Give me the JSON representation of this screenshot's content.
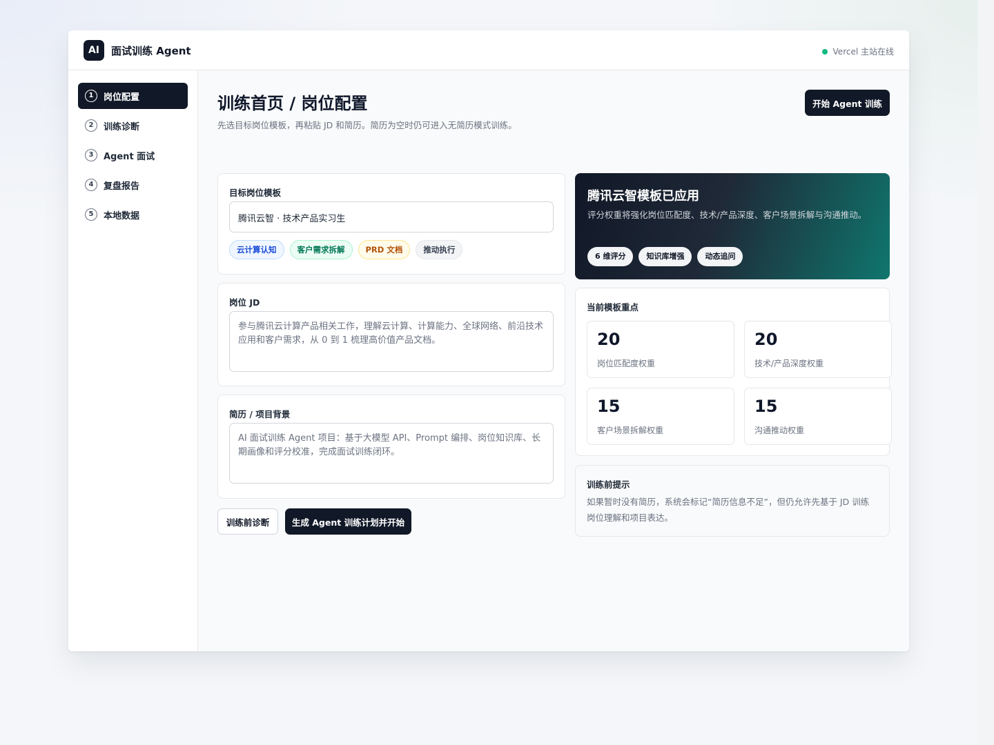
{
  "app": {
    "logo": "AI",
    "title": "面试训练 Agent",
    "status": "Vercel 主站在线"
  },
  "sidebar": {
    "items": [
      {
        "num": "1",
        "label": "岗位配置"
      },
      {
        "num": "2",
        "label": "训练诊断"
      },
      {
        "num": "3",
        "label": "Agent 面试"
      },
      {
        "num": "4",
        "label": "复盘报告"
      },
      {
        "num": "5",
        "label": "本地数据"
      }
    ]
  },
  "page": {
    "title": "训练首页 / 岗位配置",
    "subtitle": "先选目标岗位模板，再粘贴 JD 和简历。简历为空时仍可进入无简历模式训练。",
    "start_button": "开始 Agent 训练"
  },
  "template": {
    "label": "目标岗位模板",
    "value": "腾讯云智 · 技术产品实习生",
    "tags": [
      "云计算认知",
      "客户需求拆解",
      "PRD 文档",
      "推动执行"
    ]
  },
  "jd": {
    "label": "岗位 JD",
    "value": "参与腾讯云计算产品相关工作，理解云计算、计算能力、全球网络、前沿技术应用和客户需求，从 0 到 1 梳理高价值产品文档。"
  },
  "resume": {
    "label": "简历 / 项目背景",
    "value": "AI 面试训练 Agent 项目：基于大模型 API、Prompt 编排、岗位知识库、长期画像和评分校准，完成面试训练闭环。"
  },
  "actions": {
    "diagnose": "训练前诊断",
    "generate": "生成 Agent 训练计划并开始"
  },
  "hero": {
    "title": "腾讯云智模板已应用",
    "desc": "评分权重将强化岗位匹配度、技术/产品深度、客户场景拆解与沟通推动。",
    "chips": [
      "6 维评分",
      "知识库增强",
      "动态追问"
    ]
  },
  "focus": {
    "title": "当前模板重点",
    "stats": [
      {
        "value": "20",
        "label": "岗位匹配度权重"
      },
      {
        "value": "20",
        "label": "技术/产品深度权重"
      },
      {
        "value": "15",
        "label": "客户场景拆解权重"
      },
      {
        "value": "15",
        "label": "沟通推动权重"
      }
    ]
  },
  "tip": {
    "title": "训练前提示",
    "text": "如果暂时没有简历，系统会标记“简历信息不足”，但仍允许先基于 JD 训练岗位理解和项目表达。"
  },
  "colors": {
    "primary": "#111827",
    "accent_teal": "#0f766e",
    "status_online": "#10b981"
  }
}
